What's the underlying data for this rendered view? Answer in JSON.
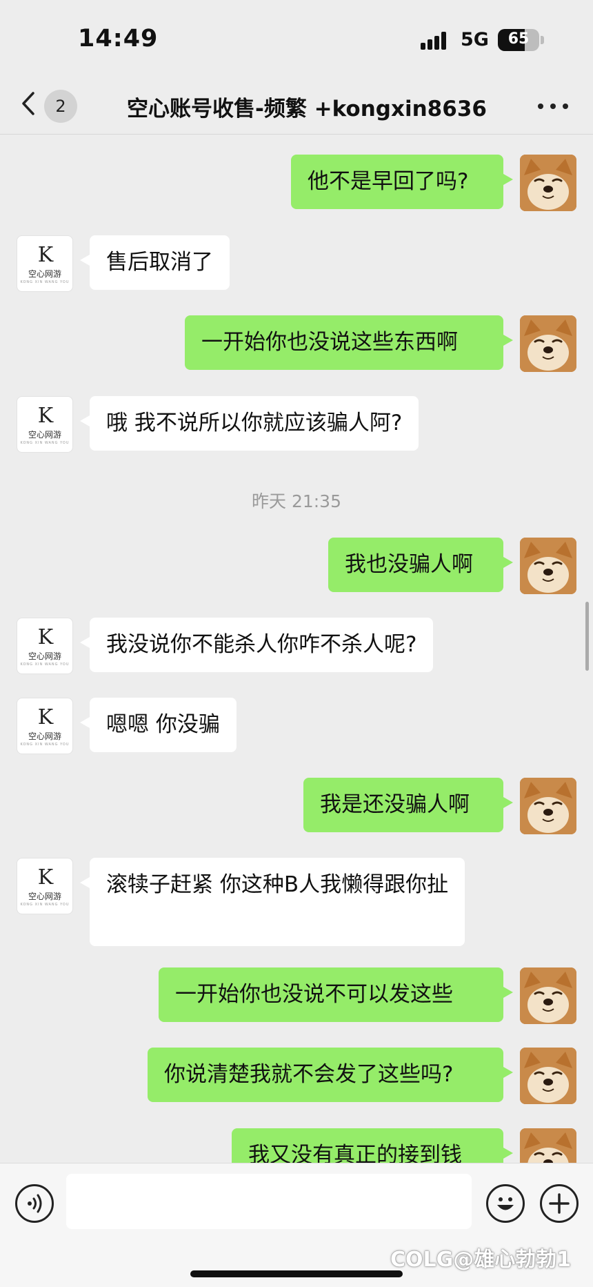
{
  "status_bar": {
    "time": "14:49",
    "network": "5G",
    "battery": "65",
    "battery_level": 0.65
  },
  "nav": {
    "unread_count": "2",
    "title": "空心账号收售-频繁 +kongxin8636"
  },
  "logo": {
    "mark": "K",
    "name": "空心网游",
    "sub": "KONG XIN WANG YOU"
  },
  "timestamp": "昨天 21:35",
  "messages": [
    {
      "side": "me",
      "text": "他不是早回了吗?"
    },
    {
      "side": "them",
      "text": "售后取消了"
    },
    {
      "side": "me",
      "text": "一开始你也没说这些东西啊"
    },
    {
      "side": "them",
      "text": "哦 我不说所以你就应该骗人阿?"
    },
    {
      "side": "me",
      "text": "我也没骗人啊"
    },
    {
      "side": "them",
      "text": "我没说你不能杀人你咋不杀人呢?"
    },
    {
      "side": "them",
      "text": "嗯嗯 你没骗"
    },
    {
      "side": "me",
      "text": "我是还没骗人啊"
    },
    {
      "side": "them",
      "text": "滚犊子赶紧 你这种B人我懒得跟你扯"
    },
    {
      "side": "me",
      "text": "一开始你也没说不可以发这些"
    },
    {
      "side": "me",
      "text": "你说清楚我就不会发了这些吗?"
    },
    {
      "side": "me",
      "text": "我又没有真正的接到钱"
    }
  ],
  "watermark": "COLG@雄心勃勃1",
  "colors": {
    "bg": "#ededed",
    "my_bubble": "#95ec69",
    "their_bubble": "#ffffff"
  }
}
